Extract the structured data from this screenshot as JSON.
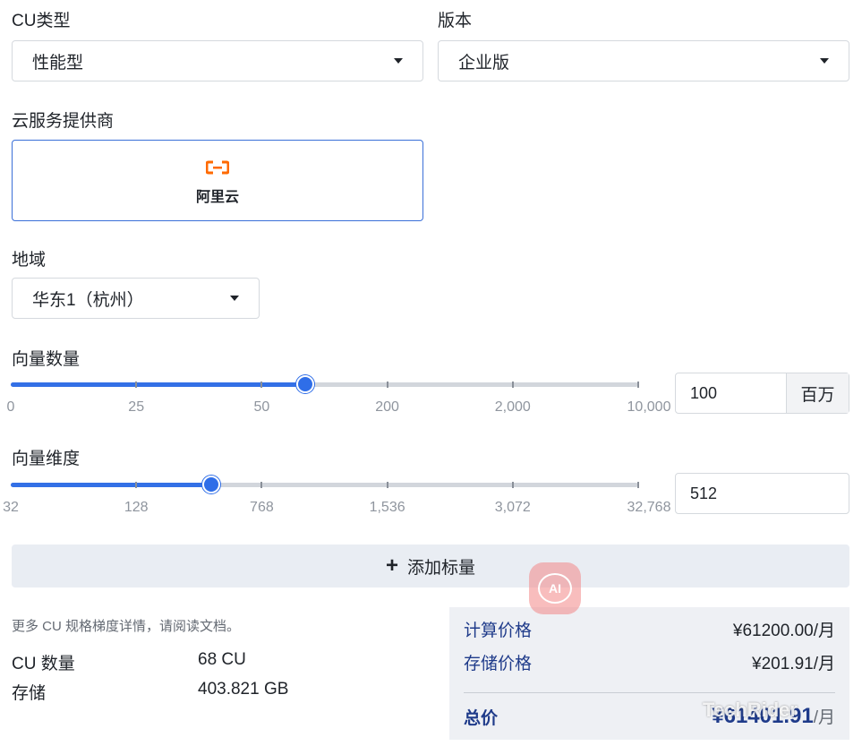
{
  "cu_type": {
    "label": "CU类型",
    "value": "性能型"
  },
  "edition": {
    "label": "版本",
    "value": "企业版"
  },
  "provider": {
    "label": "云服务提供商",
    "name": "阿里云",
    "icon": "aliyun-logo",
    "accent": "#ff6a00"
  },
  "region": {
    "label": "地域",
    "value": "华东1（杭州）"
  },
  "vector_count": {
    "label": "向量数量",
    "ticks": [
      "0",
      "25",
      "50",
      "200",
      "2,000",
      "10,000"
    ],
    "slider_fraction": 0.47,
    "input_value": "100",
    "unit": "百万"
  },
  "vector_dim": {
    "label": "向量维度",
    "ticks": [
      "32",
      "128",
      "768",
      "1,536",
      "3,072",
      "32,768"
    ],
    "slider_fraction": 0.32,
    "input_value": "512"
  },
  "add_scalar": {
    "label": "添加标量"
  },
  "doc_note": {
    "prefix": "更多 CU 规格梯度详情，请阅读",
    "link": "文档",
    "suffix": "。"
  },
  "summary": {
    "cu_count_label": "CU 数量",
    "cu_count_value": "68 CU",
    "storage_label": "存储",
    "storage_value": "403.821 GB"
  },
  "pricing": {
    "compute_label": "计算价格",
    "compute_value": "¥61200.00/月",
    "storage_label": "存储价格",
    "storage_value": "¥201.91/月",
    "total_label": "总价",
    "total_value": "¥61401.91",
    "total_unit": "/月"
  },
  "overlay": {
    "ai_badge": "AI",
    "watermark": "TechRider"
  },
  "colors": {
    "accent": "#3370e6",
    "label_blue": "#1f3b8a"
  }
}
